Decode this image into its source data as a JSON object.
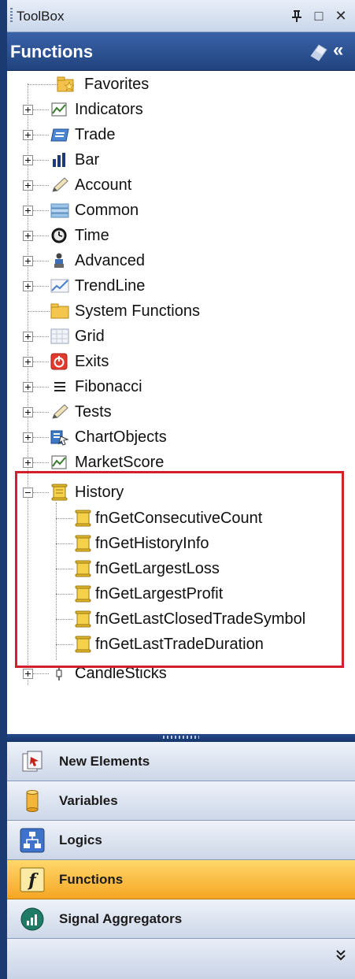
{
  "toolbox": {
    "title": "ToolBox",
    "pin_glyph": "Ԅ",
    "max_glyph": "□",
    "close_glyph": "✕"
  },
  "functions_header": {
    "title": "Functions",
    "collapse_glyph": "«"
  },
  "tree": {
    "items": [
      {
        "label": "Favorites",
        "icon": "star-folder-icon"
      },
      {
        "label": "Indicators",
        "icon": "indicator-chart-icon"
      },
      {
        "label": "Trade",
        "icon": "trade-window-icon"
      },
      {
        "label": "Bar",
        "icon": "bar-chart-icon"
      },
      {
        "label": "Account",
        "icon": "pencil-icon"
      },
      {
        "label": "Common",
        "icon": "common-stack-icon"
      },
      {
        "label": "Time",
        "icon": "clock-icon"
      },
      {
        "label": "Advanced",
        "icon": "advanced-figure-icon"
      },
      {
        "label": "TrendLine",
        "icon": "trendline-icon"
      },
      {
        "label": "System Functions",
        "icon": "folder-icon"
      },
      {
        "label": "Grid",
        "icon": "grid-icon"
      },
      {
        "label": "Exits",
        "icon": "exit-power-icon"
      },
      {
        "label": "Fibonacci",
        "icon": "fibonacci-lines-icon"
      },
      {
        "label": "Tests",
        "icon": "pencil-icon"
      },
      {
        "label": "ChartObjects",
        "icon": "chart-object-icon"
      },
      {
        "label": "MarketScore",
        "icon": "indicator-chart-icon"
      },
      {
        "label": "History",
        "icon": "scroll-icon"
      },
      {
        "label": "CandleSticks",
        "icon": "candlestick-icon"
      }
    ],
    "history_children": [
      {
        "label": "fnGetConsecutiveCount"
      },
      {
        "label": "fnGetHistoryInfo"
      },
      {
        "label": "fnGetLargestLoss"
      },
      {
        "label": "fnGetLargestProfit"
      },
      {
        "label": "fnGetLastClosedTradeSymbol"
      },
      {
        "label": "fnGetLastTradeDuration"
      }
    ]
  },
  "outlook_bar": {
    "buttons": [
      {
        "label": "New Elements",
        "icon": "new-elements-icon"
      },
      {
        "label": "Variables",
        "icon": "variables-cylinder-icon"
      },
      {
        "label": "Logics",
        "icon": "logics-hierarchy-icon"
      },
      {
        "label": "Functions",
        "icon": "function-f-icon",
        "active": true
      },
      {
        "label": "Signal Aggregators",
        "icon": "signal-aggregator-icon"
      }
    ],
    "more_glyph": "»"
  },
  "colors": {
    "header_blue": "#21447f",
    "active_orange": "#f5a623",
    "highlight_red": "#d21f2b"
  }
}
